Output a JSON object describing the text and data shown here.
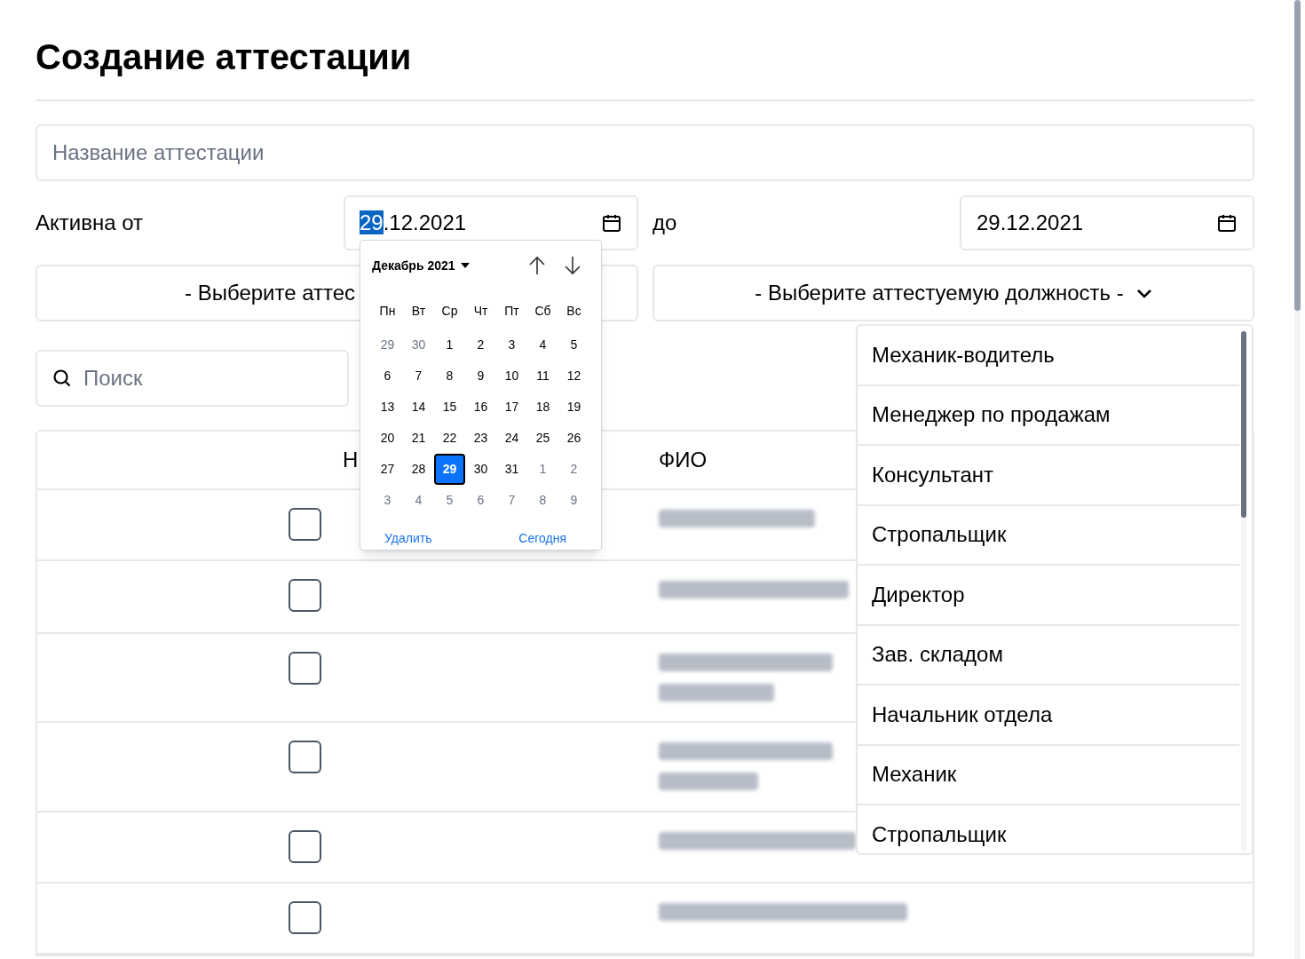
{
  "title": "Создание аттестации",
  "name_field": {
    "placeholder": "Название аттестации"
  },
  "active_from": {
    "label": "Активна от",
    "value_selected": "29",
    "value_rest": ".12.2021"
  },
  "active_to": {
    "label": "до",
    "value": "29.12.2021"
  },
  "select_left": {
    "text": "- Выберите аттес"
  },
  "select_right": {
    "text": "- Выберите аттестуемую должность -",
    "expanded": true
  },
  "search": {
    "placeholder": "Поиск"
  },
  "table": {
    "columns": [
      "Н",
      "ФИО"
    ],
    "rows": [
      {
        "checked": false
      },
      {
        "checked": false
      },
      {
        "checked": false
      },
      {
        "checked": false
      },
      {
        "checked": false
      },
      {
        "checked": false
      }
    ]
  },
  "position_options": [
    {
      "label": "Механик-водитель"
    },
    {
      "label": "Менеджер по продажам"
    },
    {
      "label": "Консультант"
    },
    {
      "label": "Стропальщик"
    },
    {
      "label": "Директор"
    },
    {
      "label": "Зав. складом"
    },
    {
      "label": "Начальник отдела"
    },
    {
      "label": "Механик"
    },
    {
      "label": "Стропальщик"
    }
  ],
  "calendar": {
    "month": "Декабрь 2021",
    "weekdays": [
      "Пн",
      "Вт",
      "Ср",
      "Чт",
      "Пт",
      "Сб",
      "Вс"
    ],
    "days": [
      {
        "label": "29",
        "outside": true,
        "selected": false
      },
      {
        "label": "30",
        "outside": true,
        "selected": false
      },
      {
        "label": "1",
        "outside": false,
        "selected": false
      },
      {
        "label": "2",
        "outside": false,
        "selected": false
      },
      {
        "label": "3",
        "outside": false,
        "selected": false
      },
      {
        "label": "4",
        "outside": false,
        "selected": false
      },
      {
        "label": "5",
        "outside": false,
        "selected": false
      },
      {
        "label": "6",
        "outside": false,
        "selected": false
      },
      {
        "label": "7",
        "outside": false,
        "selected": false
      },
      {
        "label": "8",
        "outside": false,
        "selected": false
      },
      {
        "label": "9",
        "outside": false,
        "selected": false
      },
      {
        "label": "10",
        "outside": false,
        "selected": false
      },
      {
        "label": "11",
        "outside": false,
        "selected": false
      },
      {
        "label": "12",
        "outside": false,
        "selected": false
      },
      {
        "label": "13",
        "outside": false,
        "selected": false
      },
      {
        "label": "14",
        "outside": false,
        "selected": false
      },
      {
        "label": "15",
        "outside": false,
        "selected": false
      },
      {
        "label": "16",
        "outside": false,
        "selected": false
      },
      {
        "label": "17",
        "outside": false,
        "selected": false
      },
      {
        "label": "18",
        "outside": false,
        "selected": false
      },
      {
        "label": "19",
        "outside": false,
        "selected": false
      },
      {
        "label": "20",
        "outside": false,
        "selected": false
      },
      {
        "label": "21",
        "outside": false,
        "selected": false
      },
      {
        "label": "22",
        "outside": false,
        "selected": false
      },
      {
        "label": "23",
        "outside": false,
        "selected": false
      },
      {
        "label": "24",
        "outside": false,
        "selected": false
      },
      {
        "label": "25",
        "outside": false,
        "selected": false
      },
      {
        "label": "26",
        "outside": false,
        "selected": false
      },
      {
        "label": "27",
        "outside": false,
        "selected": false
      },
      {
        "label": "28",
        "outside": false,
        "selected": false
      },
      {
        "label": "29",
        "outside": false,
        "selected": true
      },
      {
        "label": "30",
        "outside": false,
        "selected": false
      },
      {
        "label": "31",
        "outside": false,
        "selected": false
      },
      {
        "label": "1",
        "outside": true,
        "selected": false
      },
      {
        "label": "2",
        "outside": true,
        "selected": false
      },
      {
        "label": "3",
        "outside": true,
        "selected": false
      },
      {
        "label": "4",
        "outside": true,
        "selected": false
      },
      {
        "label": "5",
        "outside": true,
        "selected": false
      },
      {
        "label": "6",
        "outside": true,
        "selected": false
      },
      {
        "label": "7",
        "outside": true,
        "selected": false
      },
      {
        "label": "8",
        "outside": true,
        "selected": false
      },
      {
        "label": "9",
        "outside": true,
        "selected": false
      }
    ],
    "clear": "Удалить",
    "today": "Сегодня"
  }
}
